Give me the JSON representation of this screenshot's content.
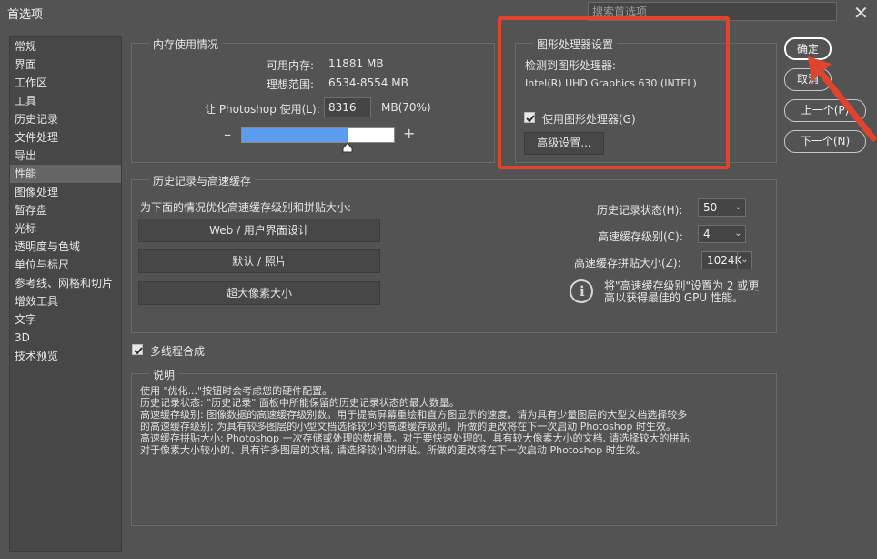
{
  "window": {
    "title": "首选项",
    "search_placeholder": "搜索首选项"
  },
  "sidebar": {
    "items": [
      {
        "label": "常规"
      },
      {
        "label": "界面"
      },
      {
        "label": "工作区"
      },
      {
        "label": "工具"
      },
      {
        "label": "历史记录"
      },
      {
        "label": "文件处理"
      },
      {
        "label": "导出"
      },
      {
        "label": "性能"
      },
      {
        "label": "图像处理"
      },
      {
        "label": "暂存盘"
      },
      {
        "label": "光标"
      },
      {
        "label": "透明度与色域"
      },
      {
        "label": "单位与标尺"
      },
      {
        "label": "参考线、网格和切片"
      },
      {
        "label": "增效工具"
      },
      {
        "label": "文字"
      },
      {
        "label": "3D"
      },
      {
        "label": "技术预览"
      }
    ],
    "active": "性能"
  },
  "memory": {
    "legend": "内存使用情况",
    "available_label": "可用内存:",
    "available_value": "11881 MB",
    "ideal_label": "理想范围:",
    "ideal_value": "6534-8554 MB",
    "let_label": "让 Photoshop 使用(L):",
    "let_value": "8316",
    "unit_percent": "MB(70%)",
    "minus": "–",
    "plus": "+",
    "slider_fraction": 0.7
  },
  "gpu": {
    "legend": "图形处理器设置",
    "detected_label": "检测到图形处理器:",
    "gpu_name": "Intel(R) UHD Graphics 630 (INTEL)",
    "use_gpu_label": "使用图形处理器(G)",
    "use_gpu_checked": true,
    "advanced_button": "高级设置..."
  },
  "history_cache": {
    "legend": "历史记录与高速缓存",
    "optimize_label": "为下面的情况优化高速缓存级别和拼贴大小:",
    "btn_web": "Web / 用户界面设计",
    "btn_default": "默认 / 照片",
    "btn_huge": "超大像素大小",
    "history_states_label": "历史记录状态(H):",
    "history_states_value": "50",
    "cache_levels_label": "高速缓存级别(C):",
    "cache_levels_value": "4",
    "cache_tile_label": "高速缓存拼贴大小(Z):",
    "cache_tile_value": "1024K",
    "tip_line1": "将\"高速缓存级别\"设置为 2 或更",
    "tip_line2": "高以获得最佳的 GPU 性能。"
  },
  "multithread": {
    "label": "多线程合成",
    "checked": true
  },
  "description": {
    "legend": "说明",
    "lines": [
      "使用 \"优化...\"按钮时会考虑您的硬件配置。",
      "历史记录状态: \"历史记录\" 面板中所能保留的历史记录状态的最大数量。",
      "高速缓存级别: 图像数据的高速缓存级别数。用于提高屏幕重绘和直方图显示的速度。请为具有少量图层的大型文档选择较多",
      "的高速缓存级别; 为具有较多图层的小型文档选择较少的高速缓存级别。所做的更改将在下一次启动 Photoshop 时生效。",
      "高速缓存拼贴大小: Photoshop 一次存储或处理的数据量。对于要快速处理的、具有较大像素大小的文档, 请选择较大的拼贴;",
      "对于像素大小较小的、具有许多图层的文档, 请选择较小的拼贴。所做的更改将在下一次启动 Photoshop 时生效。"
    ]
  },
  "actions": {
    "ok": "确定",
    "cancel": "取消",
    "prev": "上一个(P)",
    "next": "下一个(N)"
  },
  "colors": {
    "accent_highlight": "#e0442c",
    "slider_fill": "#5b9bf0",
    "background": "#535353"
  }
}
